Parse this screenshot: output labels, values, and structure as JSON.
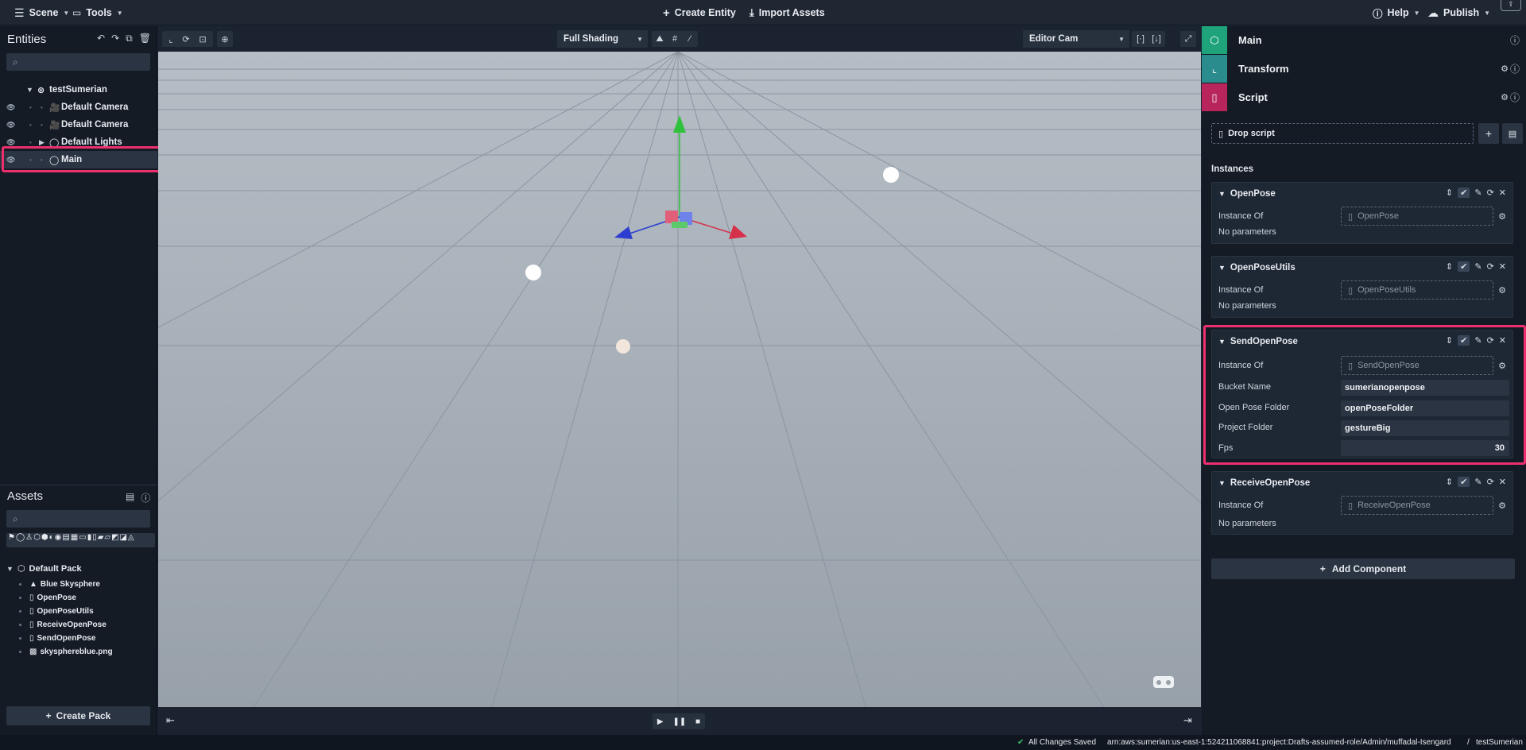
{
  "topbar": {
    "scene": "Scene",
    "tools": "Tools",
    "create_entity": "Create Entity",
    "import_assets": "Import Assets",
    "help": "Help",
    "publish": "Publish"
  },
  "entities": {
    "title": "Entities",
    "search_placeholder": "",
    "root": "testSumerian",
    "items": [
      {
        "label": "Default Camera"
      },
      {
        "label": "Default Camera"
      },
      {
        "label": "Default Lights"
      },
      {
        "label": "Main"
      }
    ]
  },
  "assets": {
    "title": "Assets",
    "search_placeholder": "",
    "pack": "Default Pack",
    "items": [
      {
        "label": "Blue Skysphere"
      },
      {
        "label": "OpenPose"
      },
      {
        "label": "OpenPoseUtils"
      },
      {
        "label": "ReceiveOpenPose"
      },
      {
        "label": "SendOpenPose"
      },
      {
        "label": "skysphereblue.png"
      }
    ],
    "create_pack": "Create Pack"
  },
  "viewport": {
    "shading": "Full Shading",
    "camera": "Editor Cam"
  },
  "inspector": {
    "entity_name": "Main",
    "components": [
      {
        "label": "Transform"
      },
      {
        "label": "Script"
      }
    ],
    "drop_script": "Drop script",
    "instances_title": "Instances",
    "instance_of_label": "Instance Of",
    "no_params": "No parameters",
    "instances": [
      {
        "name": "OpenPose",
        "instance_of": "OpenPose"
      },
      {
        "name": "OpenPoseUtils",
        "instance_of": "OpenPoseUtils"
      },
      {
        "name": "SendOpenPose",
        "instance_of": "SendOpenPose"
      },
      {
        "name": "ReceiveOpenPose",
        "instance_of": "ReceiveOpenPose"
      }
    ],
    "params": {
      "bucket_label": "Bucket Name",
      "bucket_value": "sumerianopenpose",
      "openpose_folder_label": "Open Pose Folder",
      "openpose_folder_value": "openPoseFolder",
      "project_folder_label": "Project Folder",
      "project_folder_value": "gestureBig",
      "fps_label": "Fps",
      "fps_value": "30"
    },
    "add_component": "Add Component"
  },
  "status": {
    "saved": "All Changes Saved",
    "arn": "arn:aws:sumerian:us-east-1:524211068841:project:Drafts-assumed-role/Admin/muffadal-Isengard",
    "project": "testSumerian",
    "separator": "/"
  },
  "colors": {
    "accent_highlight": "#ee2f6d",
    "main_icon": "#1fa37a",
    "transform_icon": "#2a8c8c",
    "script_icon": "#b8245c"
  }
}
